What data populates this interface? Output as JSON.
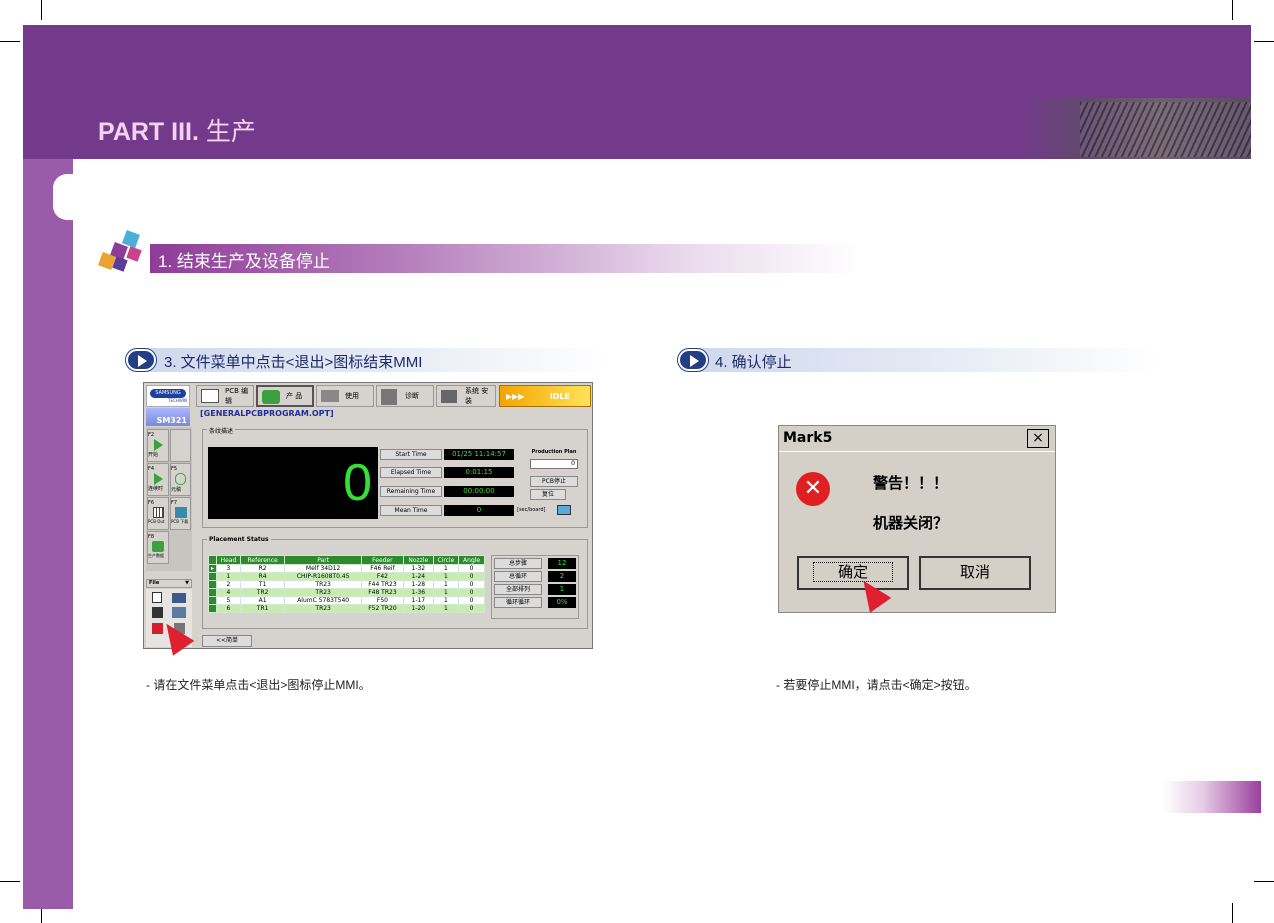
{
  "header": {
    "part_label": "PART III.",
    "part_zh": "生产"
  },
  "section": {
    "title": "1. 结束生产及设备停止"
  },
  "step3": {
    "title": "3. 文件菜单中点击<退出>图标结束MMI",
    "desc": "- 请在文件菜单点击<退出>图标停止MMI。"
  },
  "step4": {
    "title": "4. 确认停止",
    "desc": "- 若要停止MMI，请点击<确定>按钮。"
  },
  "mmi": {
    "logo": "SAMSUNG",
    "logo_sub": "TECHWIN",
    "model": "SM321",
    "tabs": {
      "pcb": "PCB 编辑",
      "product": "产 品",
      "use": "使用",
      "diag": "诊断",
      "system": "系统 安装",
      "status": "IDLE",
      "arrows": "▶▶▶"
    },
    "program": "[GENERALPCBPROGRAM.OPT]",
    "group_label": "条纹描述",
    "counter": "0",
    "labels": {
      "start": "Start Time",
      "elapsed": "Elapsed Time",
      "remaining": "Remaining Time",
      "mean": "Mean Time"
    },
    "values": {
      "start": "01/25 11:14:57",
      "elapsed": "0:01:15",
      "remaining": "00:00:00",
      "mean": "0"
    },
    "unit": "[sec/board]",
    "plan_label": "Production Plan",
    "plan_value": "0",
    "pcb_stop": "PCB停止",
    "reset": "复位",
    "side": {
      "f2": "F2",
      "start": "开始",
      "f4": "F4",
      "f5": "F5",
      "f6": "F6",
      "f7": "F7",
      "f8": "F8",
      "s1": "连续时",
      "s2": "元稿",
      "s3": "PCB Out",
      "s4": "PCB 下载",
      "s5": "生产数据",
      "file": "File"
    },
    "placement_title": "Placement Status",
    "columns": [
      "Head",
      "Reference",
      "Part",
      "Feeder",
      "Nozzle",
      "Circle",
      "Angle"
    ],
    "rows": [
      [
        "3",
        "R2",
        "Melf 34D12",
        "F46 Reif",
        "1-32",
        "1",
        "0"
      ],
      [
        "1",
        "R4",
        "CHIP-R1608T0.45",
        "F42",
        "1-24",
        "1",
        "0"
      ],
      [
        "2",
        "T1",
        "TR23",
        "F44 TR23",
        "1-28",
        "1",
        "0"
      ],
      [
        "4",
        "TR2",
        "TR23",
        "F48 TR23",
        "1-36",
        "1",
        "0"
      ],
      [
        "5",
        "A1",
        "AlumC 5783T540",
        "F50",
        "1-17",
        "1",
        "0"
      ],
      [
        "6",
        "TR1",
        "TR23",
        "F52 TR20",
        "1-20",
        "1",
        "0"
      ]
    ],
    "stats": [
      {
        "label": "总步骤",
        "value": "12"
      },
      {
        "label": "总循环",
        "value": "2"
      },
      {
        "label": "全部排列",
        "value": "1"
      },
      {
        "label": "循环循环",
        "value": "0%"
      }
    ],
    "simple_btn": "<<简单"
  },
  "dialog": {
    "title": "Mark5",
    "close": "×",
    "icon": "error-icon",
    "line1": "警告！！！",
    "line2": "机器关闭？",
    "ok": "确定",
    "cancel": "取消"
  }
}
